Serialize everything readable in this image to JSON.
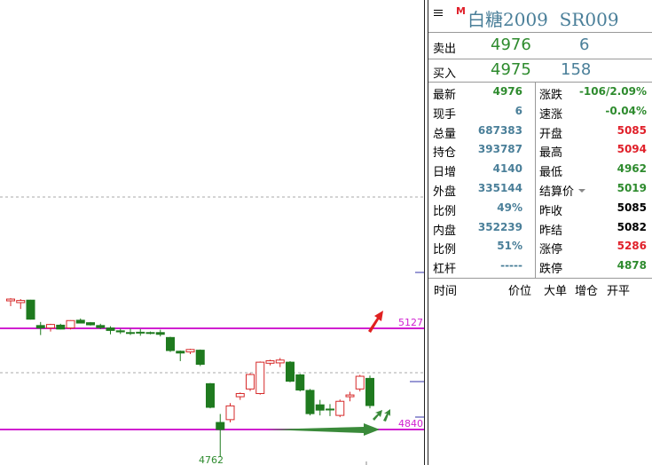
{
  "colors": {
    "up": "#d62828",
    "down": "#1f7a1f",
    "magenta": "#d020d0",
    "green_text": "#2e8b2e",
    "red_text": "#e0202a",
    "blue_text": "#4a7f99"
  },
  "chart_data": {
    "type": "candlestick",
    "hlines": [
      {
        "label": "5127",
        "value": 5127,
        "color": "magenta"
      },
      {
        "label": "4840",
        "value": 4840,
        "color": "magenta"
      }
    ],
    "low_label": "4762",
    "candles": [
      {
        "o": 5205,
        "h": 5213,
        "l": 5190,
        "c": 5210
      },
      {
        "o": 5200,
        "h": 5210,
        "l": 5182,
        "c": 5206
      },
      {
        "o": 5207,
        "h": 5208,
        "l": 5152,
        "c": 5153
      },
      {
        "o": 5135,
        "h": 5145,
        "l": 5108,
        "c": 5128
      },
      {
        "o": 5128,
        "h": 5140,
        "l": 5118,
        "c": 5138
      },
      {
        "o": 5136,
        "h": 5140,
        "l": 5124,
        "c": 5125
      },
      {
        "o": 5128,
        "h": 5150,
        "l": 5124,
        "c": 5149
      },
      {
        "o": 5150,
        "h": 5155,
        "l": 5141,
        "c": 5142
      },
      {
        "o": 5143,
        "h": 5145,
        "l": 5135,
        "c": 5137
      },
      {
        "o": 5135,
        "h": 5140,
        "l": 5125,
        "c": 5129
      },
      {
        "o": 5128,
        "h": 5133,
        "l": 5110,
        "c": 5121
      },
      {
        "o": 5120,
        "h": 5126,
        "l": 5111,
        "c": 5117
      },
      {
        "o": 5115,
        "h": 5126,
        "l": 5108,
        "c": 5113
      },
      {
        "o": 5116,
        "h": 5125,
        "l": 5106,
        "c": 5114
      },
      {
        "o": 5115,
        "h": 5118,
        "l": 5110,
        "c": 5113
      },
      {
        "o": 5115,
        "h": 5123,
        "l": 5104,
        "c": 5110
      },
      {
        "o": 5101,
        "h": 5103,
        "l": 5060,
        "c": 5064
      },
      {
        "o": 5062,
        "h": 5064,
        "l": 5034,
        "c": 5057
      },
      {
        "o": 5060,
        "h": 5069,
        "l": 5054,
        "c": 5067
      },
      {
        "o": 5065,
        "h": 5067,
        "l": 5020,
        "c": 5025
      },
      {
        "o": 4970,
        "h": 4972,
        "l": 4900,
        "c": 4903
      },
      {
        "o": 4860,
        "h": 4884,
        "l": 4762,
        "c": 4840
      },
      {
        "o": 4868,
        "h": 4915,
        "l": 4860,
        "c": 4907
      },
      {
        "o": 4933,
        "h": 4945,
        "l": 4924,
        "c": 4942
      },
      {
        "o": 4955,
        "h": 5000,
        "l": 4949,
        "c": 4996
      },
      {
        "o": 4942,
        "h": 5033,
        "l": 4939,
        "c": 5031
      },
      {
        "o": 5028,
        "h": 5038,
        "l": 5022,
        "c": 5035
      },
      {
        "o": 5029,
        "h": 5043,
        "l": 5017,
        "c": 5037
      },
      {
        "o": 5031,
        "h": 5034,
        "l": 4974,
        "c": 4977
      },
      {
        "o": 4995,
        "h": 4998,
        "l": 4948,
        "c": 4952
      },
      {
        "o": 4951,
        "h": 4955,
        "l": 4880,
        "c": 4885
      },
      {
        "o": 4910,
        "h": 4924,
        "l": 4880,
        "c": 4895
      },
      {
        "o": 4898,
        "h": 4912,
        "l": 4878,
        "c": 4897
      },
      {
        "o": 4880,
        "h": 4925,
        "l": 4875,
        "c": 4920
      },
      {
        "o": 4933,
        "h": 4947,
        "l": 4920,
        "c": 4938
      },
      {
        "o": 4955,
        "h": 4995,
        "l": 4948,
        "c": 4991
      },
      {
        "o": 4985,
        "h": 4993,
        "l": 4900,
        "c": 4908
      }
    ]
  },
  "quote": {
    "title": "白糖2009  SR009",
    "title_mark": "M",
    "sell_label": "卖出",
    "sell_price": "4976",
    "sell_vol": "6",
    "buy_label": "买入",
    "buy_price": "4975",
    "buy_vol": "158",
    "left": [
      {
        "label": "最新",
        "value": "4976",
        "color": "g"
      },
      {
        "label": "现手",
        "value": "6",
        "color": "b"
      },
      {
        "label": "总量",
        "value": "687383",
        "color": "b"
      },
      {
        "label": "持仓",
        "value": "393787",
        "color": "b"
      },
      {
        "label": "日增",
        "value": "4140",
        "color": "b"
      },
      {
        "label": "外盘",
        "value": "335144",
        "color": "b"
      },
      {
        "label": "比例",
        "value": "49%",
        "color": "b"
      },
      {
        "label": "内盘",
        "value": "352239",
        "color": "b"
      },
      {
        "label": "比例",
        "value": "51%",
        "color": "b"
      },
      {
        "label": "杠杆",
        "value": "-----",
        "color": "b"
      }
    ],
    "right": [
      {
        "label": "涨跌",
        "value": "-106/2.09%",
        "color": "g"
      },
      {
        "label": "速涨",
        "value": "-0.04%",
        "color": "g"
      },
      {
        "label": "开盘",
        "value": "5085",
        "color": "r"
      },
      {
        "label": "最高",
        "value": "5094",
        "color": "r"
      },
      {
        "label": "最低",
        "value": "4962",
        "color": "g"
      },
      {
        "label": "结算价",
        "value": "5019",
        "color": "g"
      },
      {
        "label": "昨收",
        "value": "5085",
        "color": "k"
      },
      {
        "label": "昨结",
        "value": "5082",
        "color": "k"
      },
      {
        "label": "涨停",
        "value": "5286",
        "color": "r"
      },
      {
        "label": "跌停",
        "value": "4878",
        "color": "g"
      }
    ],
    "ticks_header": [
      "时间",
      "价位",
      "大单",
      "增仓",
      "开平"
    ]
  }
}
